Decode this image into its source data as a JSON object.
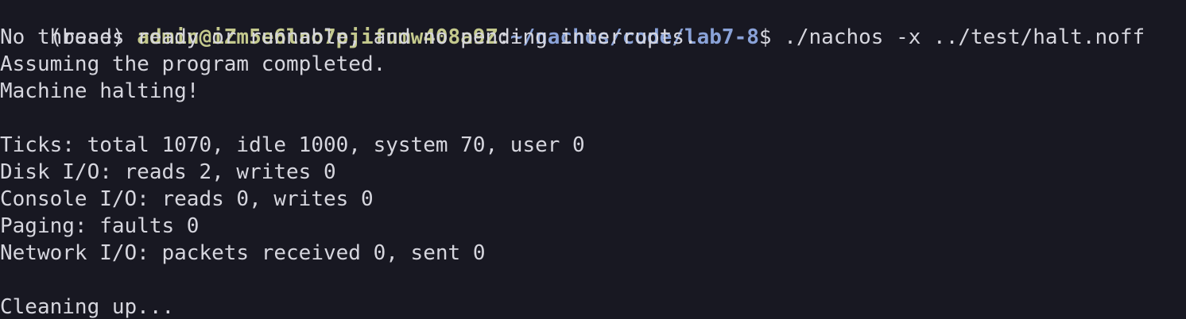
{
  "terminal": {
    "prompt": {
      "env": "(base) ",
      "user_host": "admin@iZm5e6lno7pjifumw408a9Z",
      "separator": ":",
      "path": "~/nachos/code/lab7-8",
      "symbol": "$ ",
      "command": "./nachos -x ../test/halt.noff"
    },
    "output": [
      "No threads ready or runnable, and no pending interrupts.",
      "Assuming the program completed.",
      "Machine halting!",
      "",
      "Ticks: total 1070, idle 1000, system 70, user 0",
      "Disk I/O: reads 2, writes 0",
      "Console I/O: reads 0, writes 0",
      "Paging: faults 0",
      "Network I/O: packets received 0, sent 0",
      "",
      "Cleaning up..."
    ]
  },
  "colors": {
    "background": "#181822",
    "text": "#d6d6de",
    "user_host": "#c4c98d",
    "path": "#8aa2d8"
  }
}
